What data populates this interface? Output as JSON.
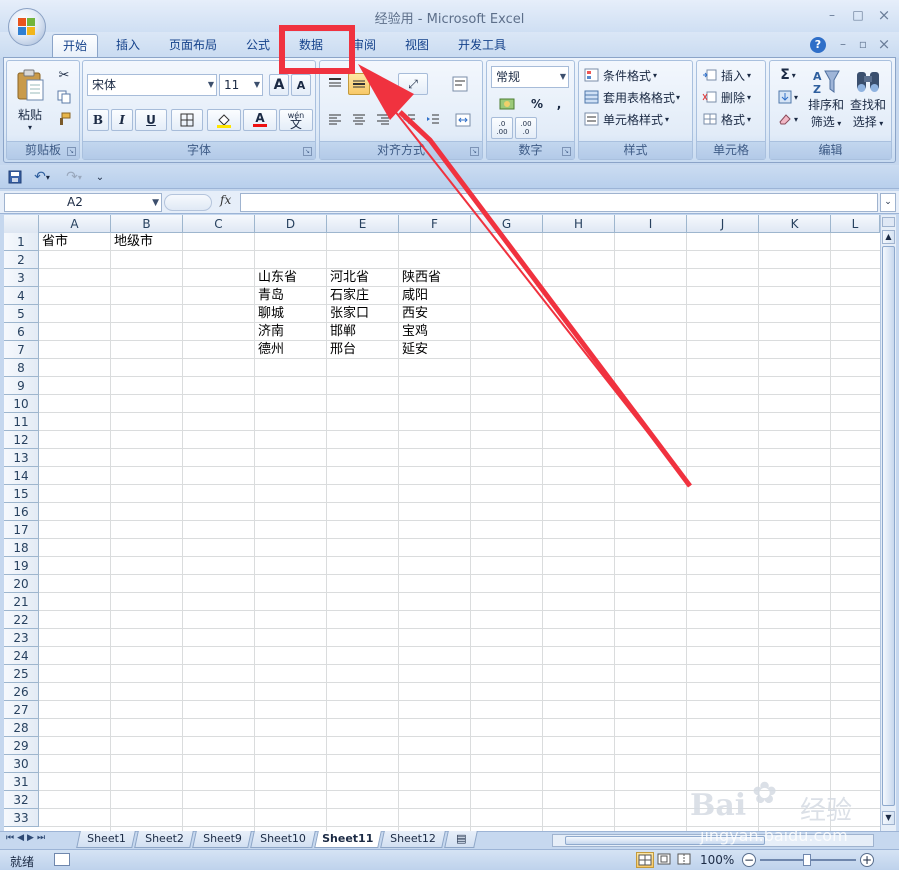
{
  "window": {
    "title": "经验用 - Microsoft Excel",
    "minimize": "–",
    "maximize": "□",
    "close": "×",
    "help": "?",
    "wb_minimize": "–",
    "wb_restore": "▫",
    "wb_close": "×"
  },
  "tabs": [
    "开始",
    "插入",
    "页面布局",
    "公式",
    "数据",
    "审阅",
    "视图",
    "开发工具"
  ],
  "clipboard": {
    "paste": "粘贴",
    "label": "剪贴板"
  },
  "font": {
    "name": "宋体",
    "size": "11",
    "grow": "A",
    "shrink": "A",
    "bold": "B",
    "italic": "I",
    "underline": "U",
    "color_a": "A",
    "phonetic_top": "wén",
    "phonetic": "文",
    "label": "字体"
  },
  "alignment": {
    "label": "对齐方式"
  },
  "number": {
    "format": "常规",
    "percent": "%",
    "comma": ",",
    "inc": ".0 .00",
    "dec": ".00 .0",
    "label": "数字"
  },
  "styles": {
    "conditional": "条件格式",
    "table": "套用表格格式",
    "cell": "单元格样式",
    "label": "样式"
  },
  "cells": {
    "insert": "插入",
    "delete": "删除",
    "format": "格式",
    "label": "单元格"
  },
  "editing": {
    "sigma": "Σ",
    "sort1": "排序和",
    "sort2": "筛选",
    "find1": "查找和",
    "find2": "选择",
    "label": "编辑"
  },
  "formula": {
    "namebox": "A2",
    "fx": "fx",
    "value": ""
  },
  "columns": [
    "A",
    "B",
    "C",
    "D",
    "E",
    "F",
    "G",
    "H",
    "I",
    "J",
    "K",
    "L"
  ],
  "rows": [
    "1",
    "2",
    "3",
    "4",
    "5",
    "6",
    "7",
    "8",
    "9",
    "10",
    "11",
    "12",
    "13",
    "14",
    "15",
    "16",
    "17",
    "18",
    "19",
    "20",
    "21",
    "22",
    "23",
    "24",
    "25",
    "26",
    "27",
    "28",
    "29",
    "30",
    "31",
    "32",
    "33"
  ],
  "cells_data": {
    "A1": "省市",
    "B1": "地级市",
    "D3": "山东省",
    "E3": "河北省",
    "F3": "陕西省",
    "D4": "青岛",
    "E4": "石家庄",
    "F4": "咸阳",
    "D5": "聊城",
    "E5": "张家口",
    "F5": "西安",
    "D6": "济南",
    "E6": "邯郸",
    "F6": "宝鸡",
    "D7": "德州",
    "E7": "邢台",
    "F7": "延安"
  },
  "sheets": [
    "Sheet1",
    "Sheet2",
    "Sheet9",
    "Sheet10",
    "Sheet11",
    "Sheet12"
  ],
  "active_sheet": "Sheet11",
  "status": {
    "ready": "就绪",
    "zoom": "100%"
  },
  "watermark": {
    "brand": "Bai",
    "brand_cn": "经验",
    "url": "jingyan.baidu.com"
  },
  "colors": {
    "highlight": "#f0323f",
    "ribbon_text": "#15428b"
  }
}
